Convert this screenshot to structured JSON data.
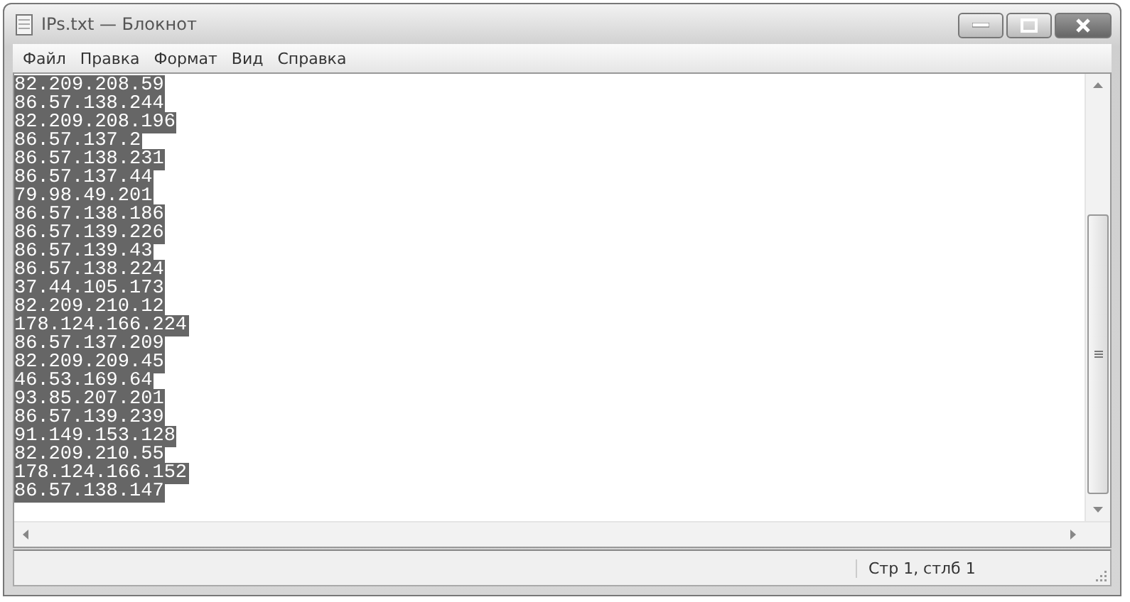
{
  "window": {
    "title": "IPs.txt — Блокнот"
  },
  "menu": [
    "Файл",
    "Правка",
    "Формат",
    "Вид",
    "Справка"
  ],
  "editor": {
    "selected": true,
    "lines": [
      "82.209.208.59",
      "86.57.138.244",
      "82.209.208.196",
      "86.57.137.2",
      "86.57.138.231",
      "86.57.137.44",
      "79.98.49.201",
      "86.57.138.186",
      "86.57.139.226",
      "86.57.139.43",
      "86.57.138.224",
      "37.44.105.173",
      "82.209.210.12",
      "178.124.166.224",
      "86.57.137.209",
      "82.209.209.45",
      "46.53.169.64",
      "93.85.207.201",
      "86.57.139.239",
      "91.149.153.128",
      "82.209.210.55",
      "178.124.166.152",
      "86.57.138.147"
    ]
  },
  "status_bar": {
    "position": "Стр 1, стлб 1"
  }
}
